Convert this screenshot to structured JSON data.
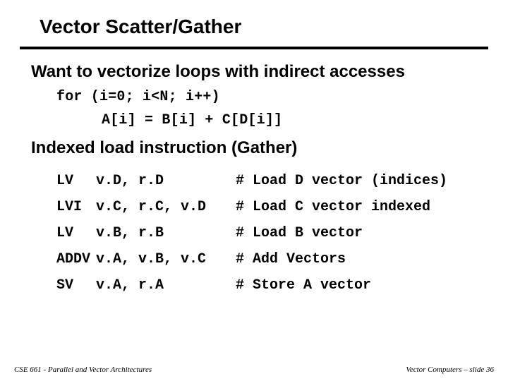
{
  "title": "Vector Scatter/Gather",
  "heading1": "Want to vectorize loops with indirect accesses",
  "code_line1": "for (i=0; i<N; i++)",
  "code_line2": "A[i] = B[i] + C[D[i]]",
  "heading2": "Indexed load instruction (Gather)",
  "instructions": [
    {
      "op": "LV",
      "args": "v.D, r.D",
      "comment": "# Load D vector (indices)"
    },
    {
      "op": "LVI",
      "args": "v.C, r.C, v.D",
      "comment": "# Load C vector indexed"
    },
    {
      "op": "LV",
      "args": "v.B, r.B",
      "comment": "# Load B vector"
    },
    {
      "op": "ADDV",
      "args": "v.A, v.B, v.C",
      "comment": "# Add Vectors"
    },
    {
      "op": "SV",
      "args": "v.A, r.A",
      "comment": "# Store A vector"
    }
  ],
  "footer_left": "CSE 661 - Parallel and Vector Architectures",
  "footer_right": "Vector Computers – slide 36"
}
